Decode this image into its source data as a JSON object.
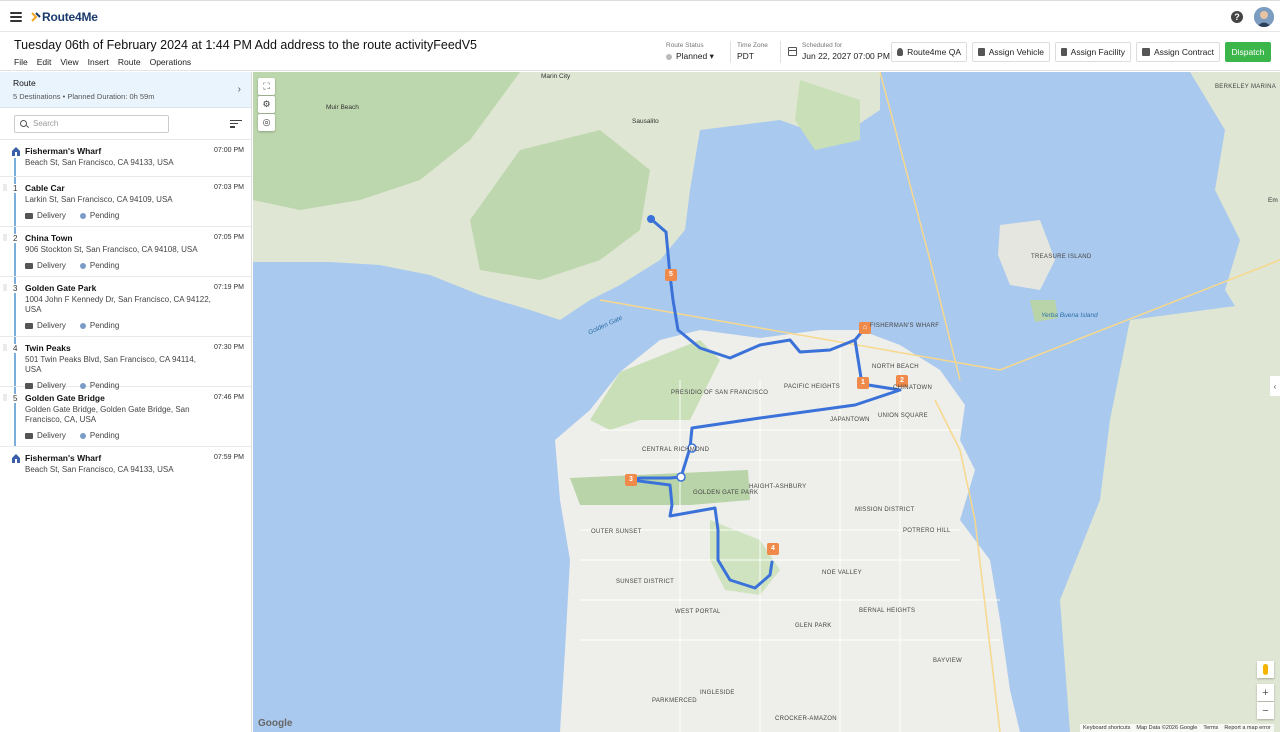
{
  "app": {
    "logo_text": "Route4Me"
  },
  "header": {
    "title": "Tuesday 06th of February 2024 at 1:44 PM Add address to the route activityFeedV5",
    "menu": [
      "File",
      "Edit",
      "View",
      "Insert",
      "Route",
      "Operations"
    ],
    "route_status_label": "Route Status",
    "route_status_value": "Planned",
    "timezone_label": "Time Zone",
    "timezone_value": "PDT",
    "scheduled_label": "Scheduled for",
    "scheduled_value": "Jun 22, 2027 07:00 PM",
    "user_button": "Route4me QA",
    "assign_vehicle": "Assign Vehicle",
    "assign_facility": "Assign Facility",
    "assign_contract": "Assign Contract",
    "dispatch": "Dispatch"
  },
  "sidebar": {
    "route_title": "Route",
    "route_summary": "5 Destinations • Planned Duration: 0h 59m",
    "search_placeholder": "Search",
    "stops": [
      {
        "num": "",
        "name": "Fisherman's Wharf",
        "address": "Beach St, San Francisco, CA 94133, USA",
        "time": "07:00 PM",
        "type": "",
        "status": "",
        "depot": true
      },
      {
        "num": "1",
        "name": "Cable Car",
        "address": "Larkin St, San Francisco, CA 94109, USA",
        "time": "07:03 PM",
        "type": "Delivery",
        "status": "Pending"
      },
      {
        "num": "2",
        "name": "China Town",
        "address": "906 Stockton St, San Francisco, CA 94108, USA",
        "time": "07:05 PM",
        "type": "Delivery",
        "status": "Pending"
      },
      {
        "num": "3",
        "name": "Golden Gate Park",
        "address": "1004 John F Kennedy Dr, San Francisco, CA 94122, USA",
        "time": "07:19 PM",
        "type": "Delivery",
        "status": "Pending"
      },
      {
        "num": "4",
        "name": "Twin Peaks",
        "address": "501 Twin Peaks Blvd, San Francisco, CA 94114, USA",
        "time": "07:30 PM",
        "type": "Delivery",
        "status": "Pending"
      },
      {
        "num": "5",
        "name": "Golden Gate Bridge",
        "address": "Golden Gate Bridge, Golden Gate Bridge, San Francisco, CA, USA",
        "time": "07:46 PM",
        "type": "Delivery",
        "status": "Pending"
      },
      {
        "num": "",
        "name": "Fisherman's Wharf",
        "address": "Beach St, San Francisco, CA 94133, USA",
        "time": "07:59 PM",
        "type": "",
        "status": "",
        "depot": true
      }
    ]
  },
  "map": {
    "labels": {
      "marin_city": "Marin City",
      "muir_beach": "Muir Beach",
      "sausalito": "Sausalito",
      "berkeley_marina": "BERKELEY MARINA",
      "treasure_island": "TREASURE ISLAND",
      "yerba_buena": "Yerba Buena Island",
      "golden_gate": "Golden Gate",
      "presidio": "PRESIDIO OF SAN FRANCISCO",
      "pacific_heights": "PACIFIC HEIGHTS",
      "north_beach": "NORTH BEACH",
      "chinatown": "CHINATOWN",
      "fishermans": "FISHERMAN'S WHARF",
      "japantown": "JAPANTOWN",
      "union_square": "UNION SQUARE",
      "central_richmond": "CENTRAL RICHMOND",
      "golden_gate_park": "GOLDEN GATE PARK",
      "haight": "HAIGHT-ASHBURY",
      "mission": "MISSION DISTRICT",
      "potrero": "POTRERO HILL",
      "outer_sunset": "OUTER SUNSET",
      "sunset": "SUNSET DISTRICT",
      "noe_valley": "NOE VALLEY",
      "west_portal": "WEST PORTAL",
      "bernal": "BERNAL HEIGHTS",
      "glen_park": "GLEN PARK",
      "bayview": "BAYVIEW",
      "ingleside": "INGLESIDE",
      "parkmerced": "PARKMERCED",
      "crocker": "CROCKER-AMAZON",
      "em": "Em"
    },
    "footer": [
      "Keyboard shortcuts",
      "Map Data ©2026 Google",
      "Terms",
      "Report a map error"
    ],
    "google": "Google",
    "zoom_in": "+",
    "zoom_out": "−"
  }
}
